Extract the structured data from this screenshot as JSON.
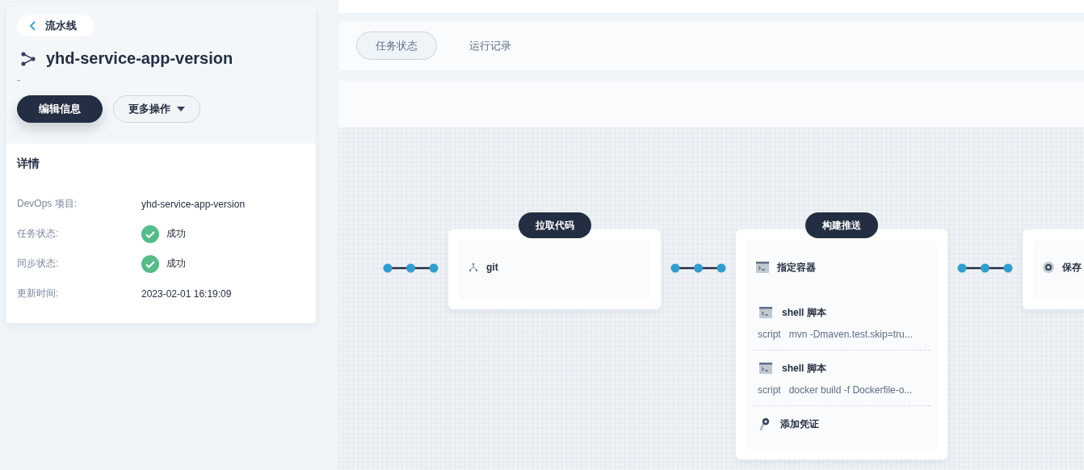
{
  "back_link": {
    "label": "流水线"
  },
  "pipeline": {
    "name": "yhd-service-app-version",
    "description": "-"
  },
  "actions": [
    {
      "label": "编辑信息",
      "kind": "primary"
    },
    {
      "label": "更多操作",
      "kind": "dropdown"
    }
  ],
  "details": {
    "title": "详情",
    "rows": [
      {
        "label": "DevOps 项目:",
        "value": "yhd-service-app-version",
        "kind": "text"
      },
      {
        "label": "任务状态:",
        "value": "成功",
        "kind": "status"
      },
      {
        "label": "同步状态:",
        "value": "成功",
        "kind": "status"
      },
      {
        "label": "更新时间:",
        "value": "2023-02-01 16:19:09",
        "kind": "text"
      }
    ]
  },
  "tabs": [
    {
      "label": "任务状态",
      "selected": true
    },
    {
      "label": "运行记录",
      "selected": false
    }
  ],
  "stages": [
    {
      "title": "拉取代码",
      "steps": [
        {
          "kind": "git",
          "name": "git"
        }
      ]
    },
    {
      "title": "构建推送",
      "steps": [
        {
          "kind": "container",
          "name": "指定容器",
          "children": [
            {
              "kind": "shell",
              "name": "shell 脚本",
              "script_label": "script",
              "script": "mvn -Dmaven.test.skip=tru..."
            },
            {
              "kind": "shell",
              "name": "shell 脚本",
              "script_label": "script",
              "script": "docker build -f Dockerfile-o..."
            },
            {
              "kind": "credential",
              "name": "添加凭证"
            }
          ]
        }
      ]
    },
    {
      "steps": [
        {
          "kind": "archive",
          "name": "保存"
        }
      ]
    }
  ]
}
